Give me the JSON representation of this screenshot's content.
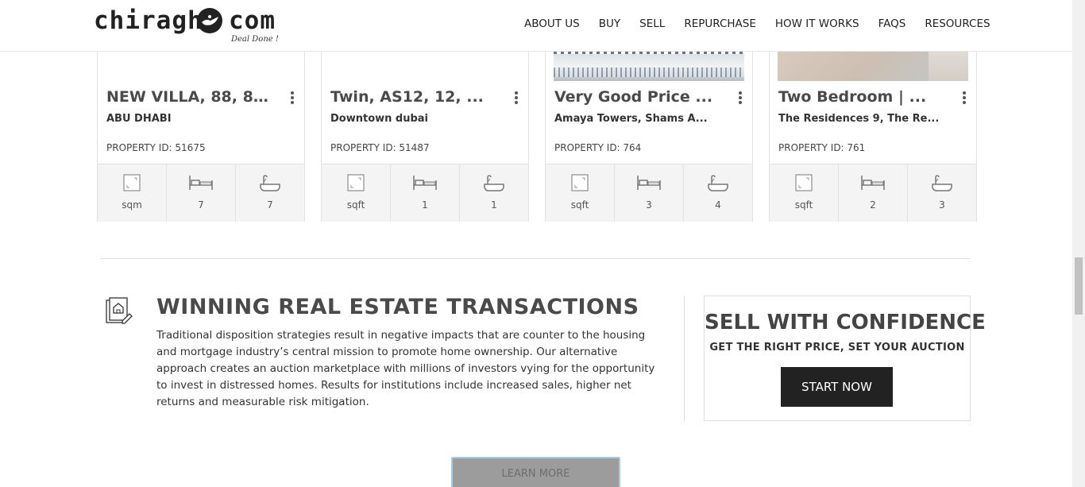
{
  "header": {
    "logo_left": "chiragh",
    "logo_right": "com",
    "tagline": "Deal Done !",
    "nav": [
      {
        "label": "ABOUT US"
      },
      {
        "label": "BUY"
      },
      {
        "label": "SELL"
      },
      {
        "label": "REPURCHASE"
      },
      {
        "label": "HOW IT WORKS"
      },
      {
        "label": "FAQS"
      },
      {
        "label": "RESOURCES"
      }
    ]
  },
  "cards": [
    {
      "title": "NEW VILLA, 88, 8...",
      "location": "ABU DHABI",
      "property_id": "PROPERTY ID: 51675",
      "area_unit": "sqm",
      "beds": "7",
      "baths": "7"
    },
    {
      "title": "Twin, AS12, 12, ...",
      "location": "Downtown dubai",
      "property_id": "PROPERTY ID: 51487",
      "area_unit": "sqft",
      "beds": "1",
      "baths": "1"
    },
    {
      "title": "Very Good Price ...",
      "location": "Amaya Towers, Shams A...",
      "property_id": "PROPERTY ID: 764",
      "area_unit": "sqft",
      "beds": "3",
      "baths": "4"
    },
    {
      "title": "Two Bedroom | ...",
      "location": "The Residences 9, The Re...",
      "property_id": "PROPERTY ID: 761",
      "area_unit": "sqft",
      "beds": "2",
      "baths": "3"
    }
  ],
  "winning": {
    "title": "WINNING REAL ESTATE TRANSACTIONS",
    "body": "Traditional disposition strategies result in negative impacts that are counter to the housing and mortgage industry’s central mission to promote home ownership. Our alternative approach creates an auction marketplace with millions of investors vying for the opportunity to invest in distressed homes. Results for institutions include increased sales, higher net returns and measurable risk mitigation."
  },
  "sell": {
    "title": "SELL WITH CONFIDENCE",
    "subtitle": "GET THE RIGHT PRICE, SET YOUR AUCTION",
    "button": "START NOW"
  },
  "learn_more": "LEARN MORE",
  "icons": {
    "logo": "genie-lamp-icon",
    "area": "area-icon",
    "bed": "bed-icon",
    "bath": "bathtub-icon",
    "menu": "kebab-menu-icon",
    "section": "property-document-icon"
  },
  "colors": {
    "primary_dark": "#222222",
    "text": "#444444",
    "feature_bg": "#f4f4f4",
    "learn_more_bg": "#9c9c9c"
  }
}
